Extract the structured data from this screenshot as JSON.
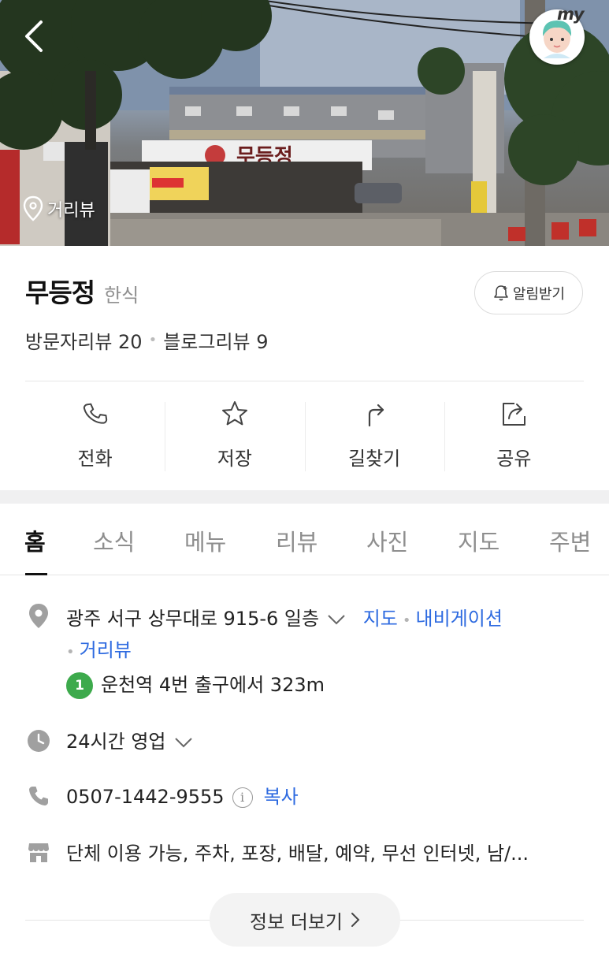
{
  "header": {
    "back_icon": "chevron-left-icon",
    "avatar_text": "my",
    "streetview_label": "거리뷰"
  },
  "place": {
    "name": "무등정",
    "category": "한식",
    "notify_label": "알림받기",
    "visitor_reviews": "방문자리뷰 20",
    "blog_reviews": "블로그리뷰 9"
  },
  "actions": [
    {
      "label": "전화",
      "icon": "phone-icon"
    },
    {
      "label": "저장",
      "icon": "star-icon"
    },
    {
      "label": "길찾기",
      "icon": "directions-icon"
    },
    {
      "label": "공유",
      "icon": "share-icon"
    }
  ],
  "tabs": [
    "홈",
    "소식",
    "메뉴",
    "리뷰",
    "사진",
    "지도",
    "주변"
  ],
  "active_tab": "홈",
  "info": {
    "address": "광주 서구 상무대로 915-6 일층",
    "address_links": [
      "지도",
      "내비게이션",
      "거리뷰"
    ],
    "station_line": "1",
    "station_text": "운천역 4번 출구에서 323m",
    "hours": "24시간 영업",
    "phone": "0507-1442-9555",
    "phone_info_glyph": "i",
    "copy_label": "복사",
    "amenities": "단체 이용 가능, 주차, 포장, 배달, 예약, 무선 인터넷, 남/...",
    "more_label": "정보 더보기"
  },
  "colors": {
    "link": "#2d6ae0",
    "station_line_1": "#3daa4c",
    "icon_gray": "#a0a0a0"
  }
}
